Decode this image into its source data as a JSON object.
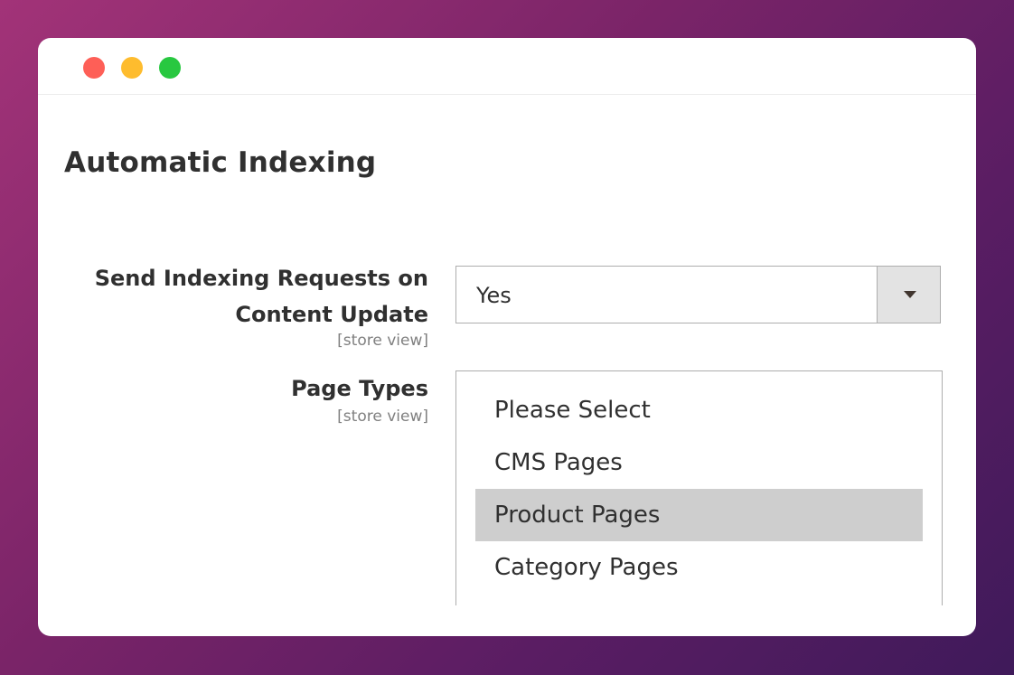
{
  "window": {
    "traffic_lights": [
      "close",
      "minimize",
      "maximize"
    ],
    "colors": {
      "close": "#fe5f57",
      "minimize": "#febc2e",
      "maximize": "#28c840"
    }
  },
  "section": {
    "title": "Automatic Indexing"
  },
  "fields": {
    "send_indexing": {
      "label_line1": "Send Indexing Requests on",
      "label_line2": "Content Update",
      "scope": "[store view]",
      "value": "Yes"
    },
    "page_types": {
      "label": "Page Types",
      "scope": "[store view]",
      "options": [
        {
          "label": "Please Select",
          "selected": false
        },
        {
          "label": "CMS Pages",
          "selected": false
        },
        {
          "label": "Product Pages",
          "selected": true
        },
        {
          "label": "Category Pages",
          "selected": false
        }
      ]
    }
  }
}
